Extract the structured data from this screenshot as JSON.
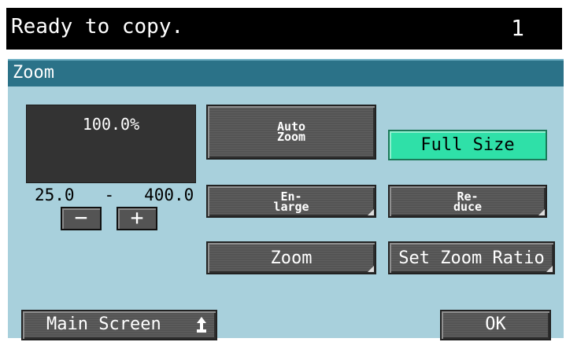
{
  "status": {
    "message": "Ready to copy.",
    "count": "1"
  },
  "title": "Zoom",
  "zoom": {
    "current": "100.0%",
    "min": "25.0",
    "separator": "-",
    "max": "400.0",
    "minus_label": "−",
    "plus_label": "+"
  },
  "buttons": {
    "auto_zoom": "Auto\nZoom",
    "full_size": "Full Size",
    "enlarge": "En-\nlarge",
    "reduce": "Re-\nduce",
    "zoom": "Zoom",
    "set_zoom_ratio": "Set Zoom Ratio"
  },
  "footer": {
    "main_screen": "Main Screen",
    "ok": "OK"
  },
  "colors": {
    "panel": "#a8d0dc",
    "title_bar": "#2b7288",
    "active": "#2fe0a8",
    "button": "#545454"
  }
}
